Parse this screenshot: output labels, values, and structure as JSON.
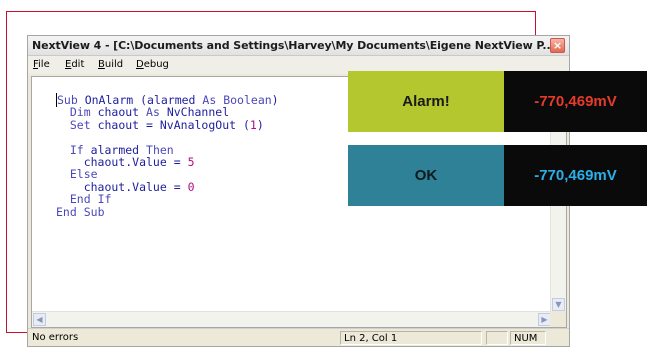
{
  "window": {
    "title": "NextView 4 - [C:\\Documents and Settings\\Harvey\\My Documents\\Eigene NextView P...",
    "close_glyph": "×"
  },
  "menu": {
    "items": [
      {
        "label": "File",
        "accel": "F"
      },
      {
        "label": "Edit",
        "accel": "E"
      },
      {
        "label": "Build",
        "accel": "B"
      },
      {
        "label": "Debug",
        "accel": "D"
      }
    ]
  },
  "code": {
    "lines": [
      "Sub OnAlarm (alarmed As Boolean)",
      "  Dim chaout As NvChannel",
      "  Set chaout = NvAnalogOut (1)",
      "",
      "  If alarmed Then",
      "    chaout.Value = 5",
      "  Else",
      "    chaout.Value = 0",
      "  End If",
      "End Sub"
    ]
  },
  "status": {
    "message": "No errors",
    "position": "Ln 2, Col 1",
    "numlock": "NUM"
  },
  "panels": {
    "alarm_label": "Alarm!",
    "alarm_value": "-770,469mV",
    "ok_label": "OK",
    "ok_value": "-770,469mV"
  },
  "colors": {
    "alarm_bg": "#b5c72f",
    "alarm_value_text": "#e63b2a",
    "ok_bg": "#2e8196",
    "ok_value_text": "#2ab0e8",
    "frame": "#c8102e"
  },
  "icons": {
    "close": "close-icon",
    "scroll_down": "arrow-down-icon",
    "scroll_left": "arrow-left-icon",
    "scroll_right": "arrow-right-icon"
  }
}
